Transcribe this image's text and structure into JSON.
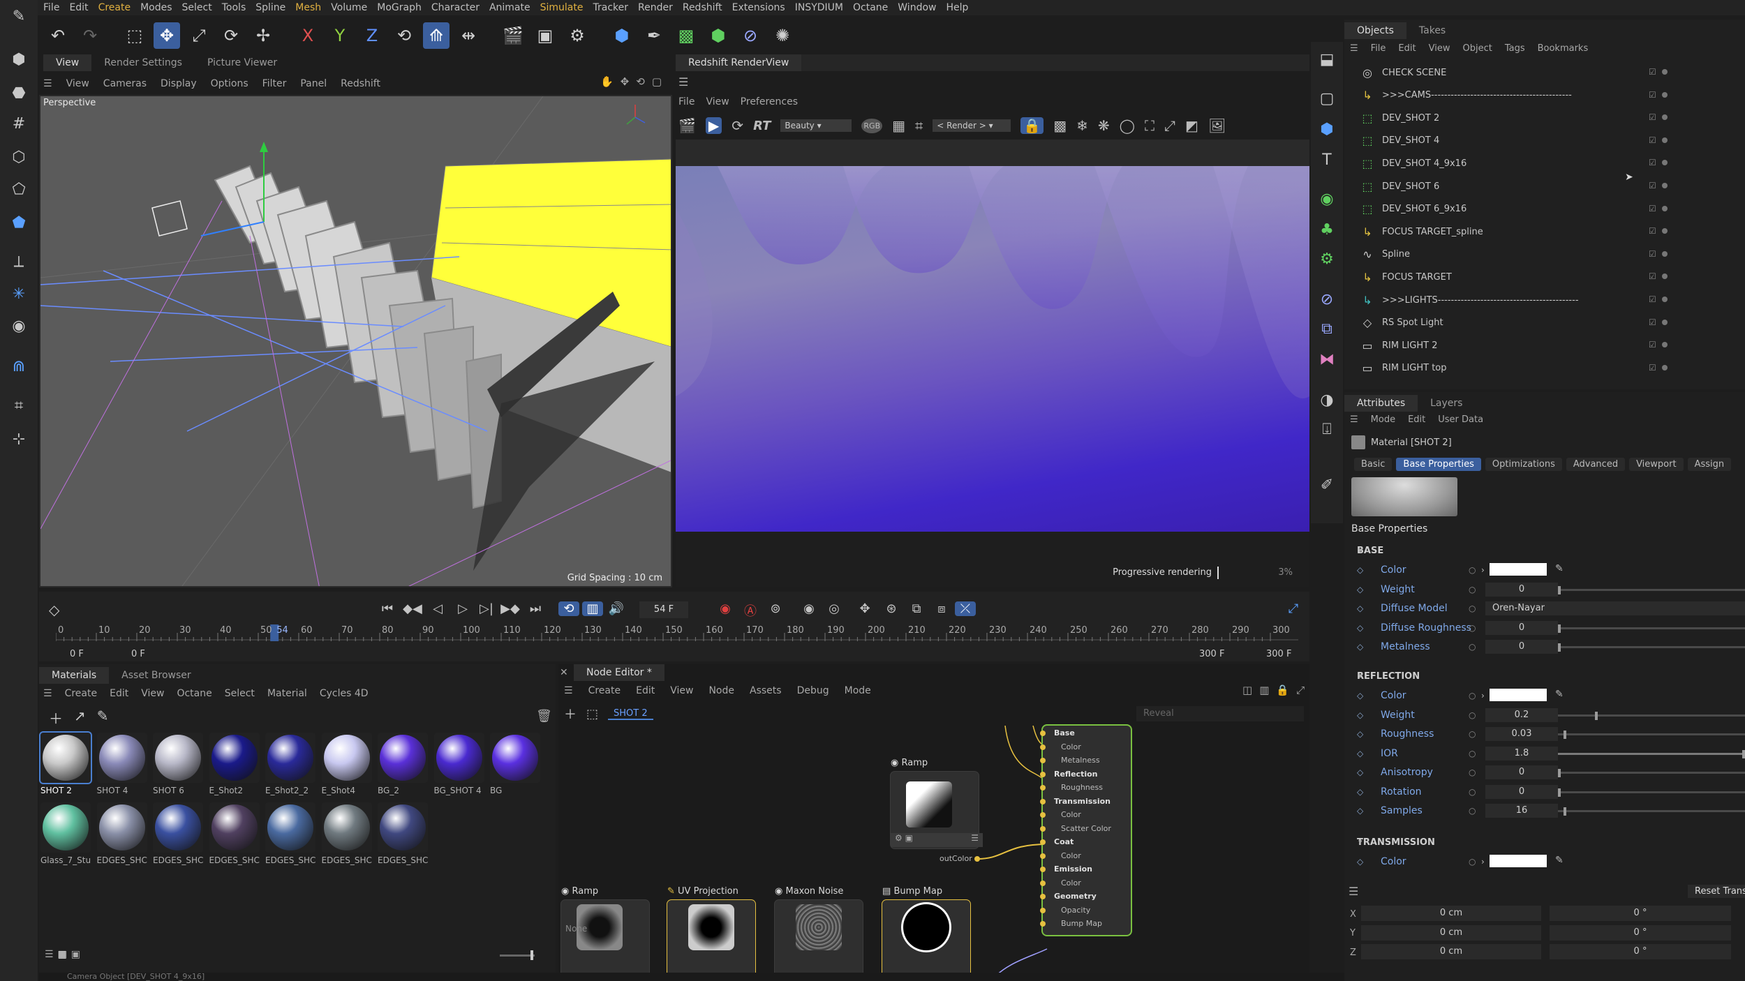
{
  "menubar": [
    "File",
    "Edit",
    "Create",
    "Modes",
    "Select",
    "Tools",
    "Spline",
    "Mesh",
    "Volume",
    "MoGraph",
    "Character",
    "Animate",
    "Simulate",
    "Tracker",
    "Render",
    "Redshift",
    "Extensions",
    "INSYDIUM",
    "Octane",
    "Window",
    "Help"
  ],
  "menubar_highlight": [
    "Create",
    "Mesh",
    "Simulate"
  ],
  "viewport_tabs": [
    "View",
    "Render Settings",
    "Picture Viewer"
  ],
  "viewport_menu": [
    "View",
    "Cameras",
    "Display",
    "Options",
    "Filter",
    "Panel",
    "Redshift"
  ],
  "viewport": {
    "label": "Perspective",
    "grid_spacing": "Grid Spacing : 10 cm"
  },
  "renderview": {
    "tab": "Redshift RenderView",
    "menu": [
      "File",
      "View",
      "Preferences"
    ],
    "aov": "Beauty",
    "camera": "< Render >",
    "status": "Progressive rendering",
    "percent": "3%"
  },
  "timeline": {
    "current_frame": "54 F",
    "ticks": [
      "0",
      "10",
      "20",
      "30",
      "40",
      "50",
      "54",
      "60",
      "70",
      "80",
      "90",
      "100",
      "110",
      "120",
      "130",
      "140",
      "150",
      "160",
      "170",
      "180",
      "190",
      "200",
      "210",
      "220",
      "230",
      "240",
      "250",
      "260",
      "270",
      "280",
      "290",
      "300"
    ],
    "start": "0 F",
    "start2": "0 F",
    "end": "300 F",
    "end2": "300 F"
  },
  "materials": {
    "tabs": [
      "Materials",
      "Asset Browser"
    ],
    "menu": [
      "Create",
      "Edit",
      "View",
      "Octane",
      "Select",
      "Material",
      "Cycles 4D"
    ],
    "items": [
      {
        "label": "SHOT 2",
        "color": "#c9c9c9",
        "sel": true
      },
      {
        "label": "SHOT 4",
        "color": "#8a8ab8"
      },
      {
        "label": "SHOT 6",
        "color": "#b8b8c8"
      },
      {
        "label": "E_Shot2",
        "color": "#1a1a8a"
      },
      {
        "label": "E_Shot2_2",
        "color": "#2a2a9a"
      },
      {
        "label": "E_Shot4",
        "color": "#c8c8f0"
      },
      {
        "label": "BG_2",
        "color": "#5a30d8"
      },
      {
        "label": "BG_SHOT 4",
        "color": "#4a2ad0"
      },
      {
        "label": "BG",
        "color": "#5a30e0"
      },
      {
        "label": "Glass_7_Stu",
        "color": "#60c0a0"
      },
      {
        "label": "EDGES_SHC",
        "color": "#8a90a8"
      },
      {
        "label": "EDGES_SHC",
        "color": "#3a50a0"
      },
      {
        "label": "EDGES_SHC",
        "color": "#504060"
      },
      {
        "label": "EDGES_SHC",
        "color": "#4a6aa0"
      },
      {
        "label": "EDGES_SHC",
        "color": "#707a80"
      },
      {
        "label": "EDGES_SHC",
        "color": "#404880"
      }
    ]
  },
  "node_editor": {
    "tab": "Node Editor *",
    "menu": [
      "Create",
      "Edit",
      "View",
      "Node",
      "Assets",
      "Debug",
      "Mode"
    ],
    "breadcrumb": "SHOT 2",
    "search_placeholder": "Reveal",
    "nodes": {
      "ramp_top": "Ramp",
      "ramp_out": "outColor",
      "ramp_bottom": "Ramp",
      "uv": "UV Projection",
      "noise": "Maxon Noise",
      "bump": "Bump Map",
      "none": "None"
    },
    "material_ports": [
      {
        "t": "Base",
        "b": true
      },
      {
        "t": "Color"
      },
      {
        "t": "Metalness"
      },
      {
        "t": "Reflection",
        "b": true
      },
      {
        "t": "Roughness"
      },
      {
        "t": "Transmission",
        "b": true
      },
      {
        "t": "Color"
      },
      {
        "t": "Scatter Color"
      },
      {
        "t": "Coat",
        "b": true
      },
      {
        "t": "Color"
      },
      {
        "t": "Emission",
        "b": true
      },
      {
        "t": "Color"
      },
      {
        "t": "Geometry",
        "b": true
      },
      {
        "t": "Opacity"
      },
      {
        "t": "Bump Map"
      }
    ]
  },
  "objects": {
    "tabs": [
      "Objects",
      "Takes"
    ],
    "menu": [
      "File",
      "Edit",
      "View",
      "Object",
      "Tags",
      "Bookmarks"
    ],
    "items": [
      {
        "name": "CHECK SCENE",
        "icon": "◎",
        "color": "#cfcfcf"
      },
      {
        "name": ">>>CAMS-------------------------------------------",
        "icon": "↳",
        "color": "#e0c040"
      },
      {
        "name": "DEV_SHOT 2",
        "icon": "⬚",
        "color": "#60d060"
      },
      {
        "name": "DEV_SHOT 4",
        "icon": "⬚",
        "color": "#60d060"
      },
      {
        "name": "DEV_SHOT 4_9x16",
        "icon": "⬚",
        "color": "#60d060"
      },
      {
        "name": "DEV_SHOT  6",
        "icon": "⬚",
        "color": "#60d060"
      },
      {
        "name": "DEV_SHOT  6_9x16",
        "icon": "⬚",
        "color": "#60d060"
      },
      {
        "name": "FOCUS TARGET_spline",
        "icon": "↳",
        "color": "#e0c040"
      },
      {
        "name": "Spline",
        "icon": "∿",
        "color": "#cfcfcf"
      },
      {
        "name": "FOCUS TARGET",
        "icon": "↳",
        "color": "#e0c040"
      },
      {
        "name": ">>>LIGHTS-------------------------------------------",
        "icon": "↳",
        "color": "#40c0c0"
      },
      {
        "name": "RS Spot Light",
        "icon": "◇",
        "color": "#cfcfcf"
      },
      {
        "name": "RIM LIGHT 2",
        "icon": "▭",
        "color": "#cfcfcf"
      },
      {
        "name": "RIM LIGHT top",
        "icon": "▭",
        "color": "#cfcfcf"
      }
    ]
  },
  "attributes": {
    "tabs": [
      "Attributes",
      "Layers"
    ],
    "menu": [
      "Mode",
      "Edit",
      "User Data"
    ],
    "material_name": "Material [SHOT 2]",
    "subtabs": [
      "Basic",
      "Base Properties",
      "Optimizations",
      "Advanced",
      "Viewport",
      "Assign"
    ],
    "active_subtab": "Base Properties",
    "section_title": "Base Properties",
    "base": {
      "header": "BASE",
      "rows": [
        {
          "label": "Color",
          "type": "color"
        },
        {
          "label": "Weight",
          "value": "0",
          "slider": 0.0
        },
        {
          "label": "Diffuse Model",
          "value": "Oren-Nayar",
          "type": "dropdown"
        },
        {
          "label": "Diffuse Roughness",
          "value": "0",
          "slider": 0.0
        },
        {
          "label": "Metalness",
          "value": "0",
          "slider": 0.0
        }
      ]
    },
    "reflection": {
      "header": "REFLECTION",
      "rows": [
        {
          "label": "Color",
          "type": "color"
        },
        {
          "label": "Weight",
          "value": "0.2",
          "slider": 0.2
        },
        {
          "label": "Roughness",
          "value": "0.03",
          "slider": 0.03
        },
        {
          "label": "IOR",
          "value": "1.8",
          "slider": 1.0
        },
        {
          "label": "Anisotropy",
          "value": "0",
          "slider": 0.0
        },
        {
          "label": "Rotation",
          "value": "0",
          "slider": 0.0
        },
        {
          "label": "Samples",
          "value": "16",
          "slider": 0.03
        }
      ]
    },
    "transmission": {
      "header": "TRANSMISSION",
      "rows": [
        {
          "label": "Color",
          "type": "color"
        }
      ]
    }
  },
  "coords": {
    "reset": "Reset Transform",
    "rows": [
      {
        "axis": "X",
        "pos": "0 cm",
        "rot": "0 °"
      },
      {
        "axis": "Y",
        "pos": "0 cm",
        "rot": "0 °"
      },
      {
        "axis": "Z",
        "pos": "0 cm",
        "rot": "0 °"
      }
    ]
  },
  "statusbar": "Camera Object [DEV_SHOT 4_9x16]"
}
